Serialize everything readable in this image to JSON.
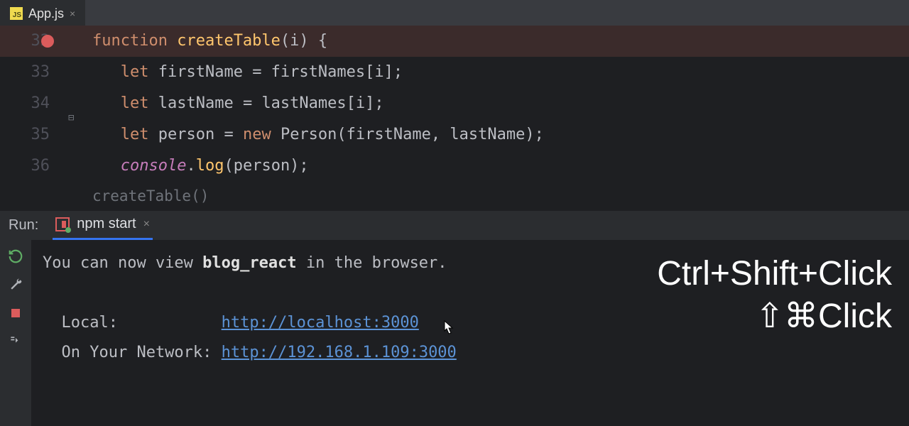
{
  "tabs": [
    {
      "icon": "JS",
      "label": "App.js",
      "close": "×"
    }
  ],
  "editor": {
    "lines": [
      {
        "num": "32",
        "breakpoint": true,
        "highlight": true,
        "tokens": [
          {
            "t": "function",
            "c": "kw"
          },
          {
            "t": " ",
            "c": ""
          },
          {
            "t": "createTable",
            "c": "fn"
          },
          {
            "t": "(",
            "c": "punct"
          },
          {
            "t": "i",
            "c": "param"
          },
          {
            "t": ") {",
            "c": "punct"
          }
        ]
      },
      {
        "num": "33",
        "tokens": [
          {
            "t": "   ",
            "c": ""
          },
          {
            "t": "let",
            "c": "kw"
          },
          {
            "t": " firstName = firstNames[i];",
            "c": "ident"
          }
        ]
      },
      {
        "num": "34",
        "tokens": [
          {
            "t": "   ",
            "c": ""
          },
          {
            "t": "let",
            "c": "kw"
          },
          {
            "t": " lastName = lastNames[i];",
            "c": "ident"
          }
        ]
      },
      {
        "num": "35",
        "tokens": [
          {
            "t": "   ",
            "c": ""
          },
          {
            "t": "let",
            "c": "kw"
          },
          {
            "t": " person = ",
            "c": "ident"
          },
          {
            "t": "new",
            "c": "kw"
          },
          {
            "t": " Person(firstName, lastName);",
            "c": "ident"
          }
        ]
      },
      {
        "num": "36",
        "tokens": [
          {
            "t": "   ",
            "c": ""
          },
          {
            "t": "console",
            "c": "console"
          },
          {
            "t": ".",
            "c": "punct"
          },
          {
            "t": "log",
            "c": "method"
          },
          {
            "t": "(person);",
            "c": "ident"
          }
        ]
      }
    ],
    "hint": "createTable()"
  },
  "run": {
    "label": "Run:",
    "tab_label": "npm start",
    "tab_close": "×"
  },
  "terminal": {
    "line1_prefix": "You can now view ",
    "line1_bold": "blog_react",
    "line1_suffix": " in the browser.",
    "local_label": "  Local:           ",
    "local_url": "http://localhost:3000",
    "network_label": "  On Your Network: ",
    "network_url": "http://192.168.1.109:3000"
  },
  "overlay": {
    "row1": "Ctrl+Shift+Click",
    "row2": "⇧⌘Click"
  }
}
